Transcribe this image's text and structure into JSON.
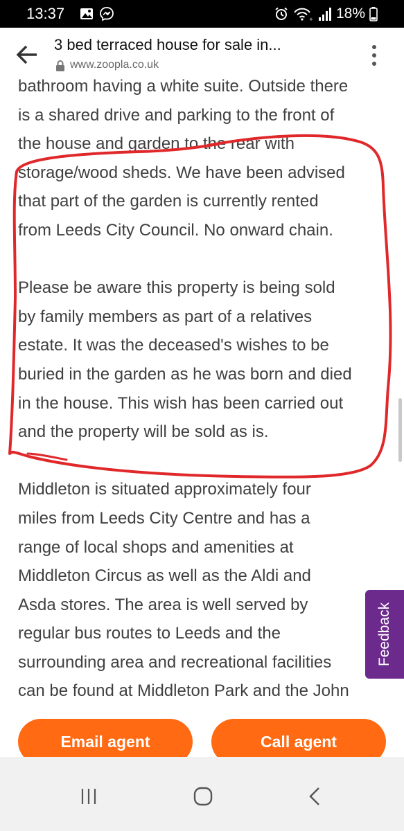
{
  "status_bar": {
    "time": "13:37",
    "battery": "18%"
  },
  "header": {
    "title": "3 bed terraced house for sale in...",
    "url": "www.zoopla.co.uk"
  },
  "description": {
    "lines_a": [
      "bathroom having a white suite. Outside there",
      "is a shared drive and parking to the front of",
      "the house and garden to the rear with",
      "storage/wood sheds. We have been advised",
      "that part of the garden is currently rented",
      "from Leeds City Council. No onward chain."
    ],
    "lines_b": [
      "Please be aware this property is being sold",
      "by family members as part of a relatives",
      "estate. It was the deceased's wishes to be",
      "buried in the garden as he was born and died",
      "in the house. This wish has been carried out",
      "and the property will be sold as is."
    ],
    "lines_c": [
      "Middleton is situated approximately four",
      "miles from Leeds City Centre and has a",
      "range of local shops and amenities at",
      "Middleton Circus as well as the Aldi and",
      "Asda stores. The area is well served by",
      "regular bus routes to Leeds and the",
      "surrounding area and recreational facilities",
      "can be found at Middleton Park and the John"
    ]
  },
  "feedback": {
    "label": "Feedback"
  },
  "actions": {
    "email": "Email agent",
    "call": "Call agent"
  },
  "colors": {
    "accent": "#ff6a13",
    "feedback": "#6b2a8c",
    "annotation": "#e0282b",
    "text": "#404040"
  },
  "icons": {
    "status_left": [
      "gallery-icon",
      "messenger-icon"
    ],
    "status_right": [
      "alarm-icon",
      "wifi-icon",
      "signal-icon",
      "battery-icon"
    ],
    "nav": [
      "recent-apps-icon",
      "home-icon",
      "back-icon"
    ]
  }
}
